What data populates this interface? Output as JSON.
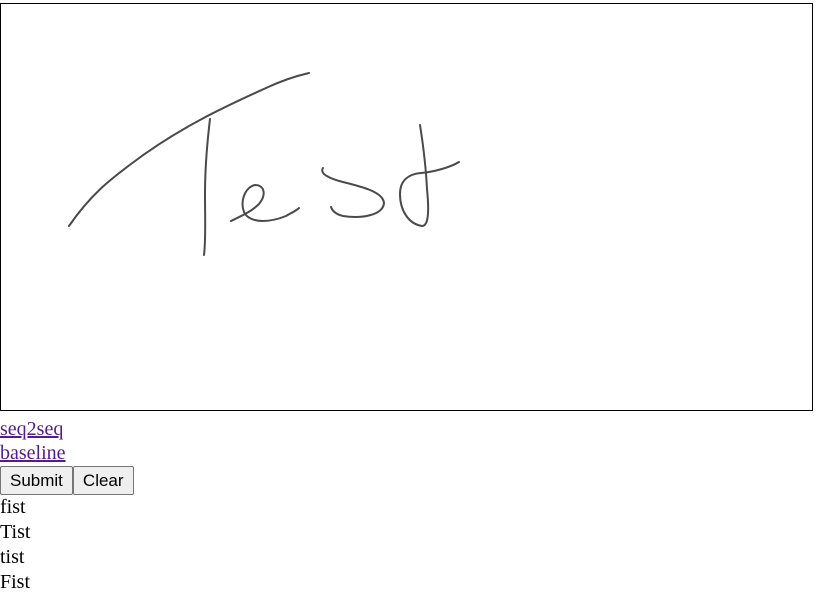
{
  "links": [
    {
      "label": "seq2seq"
    },
    {
      "label": "baseline"
    }
  ],
  "buttons": {
    "submit_label": "Submit",
    "clear_label": "Clear"
  },
  "results": [
    "fist",
    "Tist",
    "tist",
    "Fist"
  ],
  "colors": {
    "ink": "#4a4a4a",
    "link_visited": "#551a8b",
    "button_bg": "#efefef",
    "canvas_border": "#000000"
  }
}
